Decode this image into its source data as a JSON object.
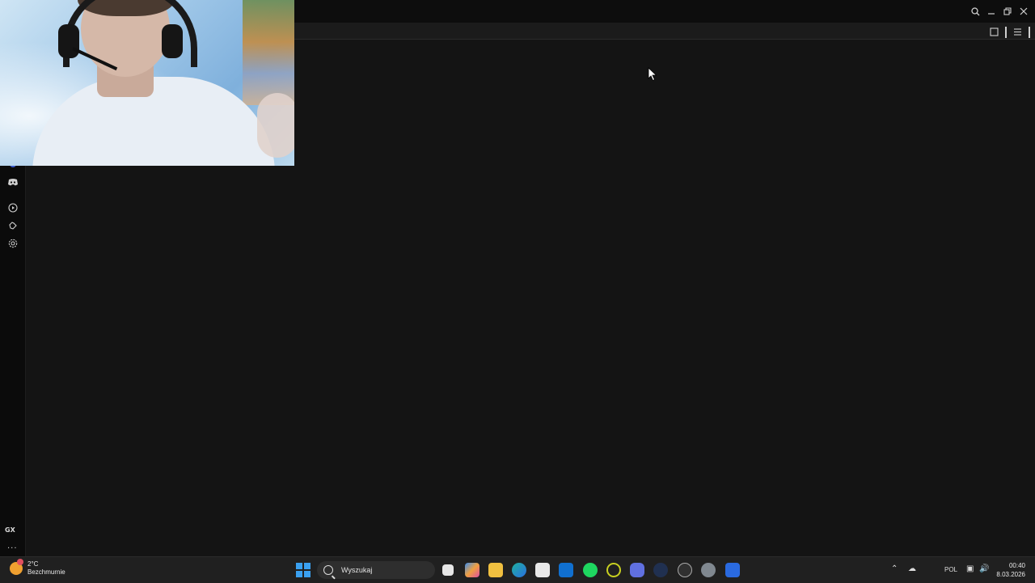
{
  "window": {
    "controls": {
      "search_icon": "search-icon",
      "minimize": "minimize-icon",
      "restore": "restore-icon",
      "close": "close-icon"
    }
  },
  "sidebar": {
    "items": [
      {
        "name": "discord",
        "icon": "discord-icon"
      },
      {
        "name": "player",
        "icon": "play-circle-icon"
      },
      {
        "name": "extensions",
        "icon": "puzzle-icon"
      },
      {
        "name": "settings",
        "icon": "gear-icon"
      }
    ],
    "gx_label": "GX",
    "more_label": "..."
  },
  "taskbar": {
    "weather": {
      "temperature": "2°C",
      "condition": "Bezchmurnie"
    },
    "search_placeholder": "Wyszukaj",
    "apps": [
      "task-view-icon",
      "copilot-icon",
      "file-explorer-icon",
      "edge-icon",
      "microsoft-store-icon",
      "outlook-icon",
      "spotify-icon",
      "opera-gx-icon",
      "discord-icon",
      "steam-icon",
      "obs-icon",
      "settings-icon",
      "roblox-icon"
    ],
    "tray": {
      "language": "POL"
    },
    "clock": {
      "time": "00:40",
      "date": "8.03.2026"
    }
  },
  "colors": {
    "accent": "#3aa0f0",
    "background": "#141414",
    "sidebar": "#0b0b0b",
    "taskbar": "#202020"
  }
}
